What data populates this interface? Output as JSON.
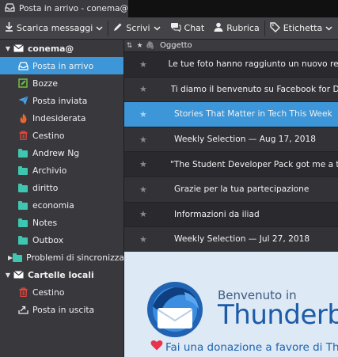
{
  "tab": {
    "title": "Posta in arrivo - conema@"
  },
  "toolbar": {
    "get_messages": "Scarica messaggi",
    "write": "Scrivi",
    "chat": "Chat",
    "address_book": "Rubrica",
    "tag": "Etichetta"
  },
  "sidebar": {
    "account": "conema@",
    "inbox": "Posta in arrivo",
    "drafts": "Bozze",
    "sent": "Posta inviata",
    "junk": "Indesiderata",
    "trash": "Cestino",
    "folders": [
      "Andrew Ng",
      "Archivio",
      "diritto",
      "economia",
      "Notes",
      "Outbox",
      "Problemi di sincronizzazione"
    ],
    "local_account": "Cartelle locali",
    "local_trash": "Cestino",
    "local_outbox": "Posta in uscita"
  },
  "message_list": {
    "subject_header": "Oggetto",
    "messages": [
      "Le tue foto hanno raggiunto un nuovo record su Google Maps",
      "Ti diamo il benvenuto su Facebook for Developers",
      "Stories That Matter in Tech This Week",
      "Weekly Selection — Aug 17, 2018",
      "\"The Student Developer Pack got me a tech job 📕\"",
      "Grazie per la tua partecipazione",
      "Informazioni da iliad",
      "Weekly Selection — Jul 27, 2018"
    ]
  },
  "preview": {
    "welcome": "Benvenuto in",
    "brand": "Thunderbird",
    "donate": "Fai una donazione a favore di Thunderbird"
  },
  "colors": {
    "accent": "#3c96d8",
    "folder": "#3fc6b0",
    "junk": "#e8672a",
    "trash": "#e0463d",
    "drafts": "#74c043",
    "sent": "#4aa3e8",
    "heart": "#e8334a",
    "brand": "#1d5aa8"
  }
}
